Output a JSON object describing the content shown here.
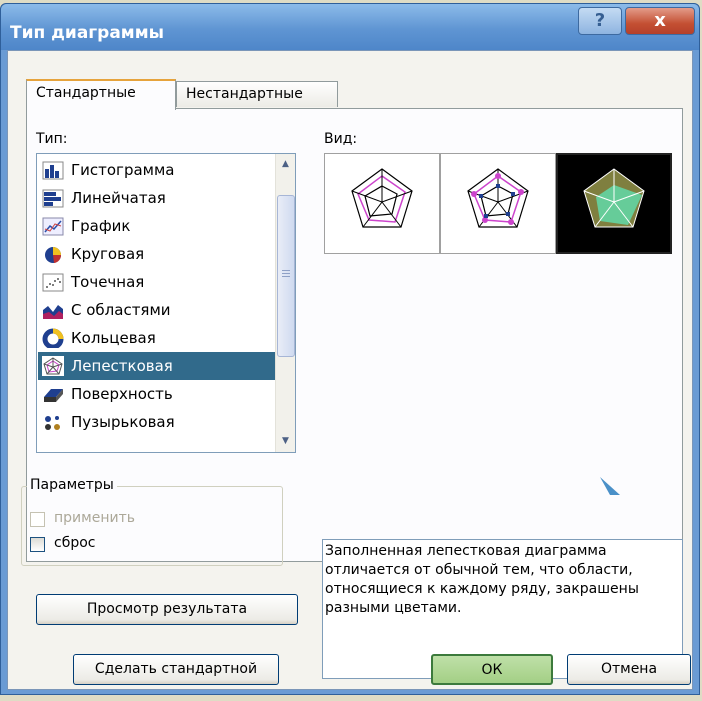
{
  "window": {
    "title": "Тип диаграммы",
    "help_label": "?",
    "close_label": "x"
  },
  "tabs": [
    {
      "label": "Стандартные",
      "active": true
    },
    {
      "label": "Нестандартные",
      "active": false
    }
  ],
  "type_section": {
    "label": "Тип:",
    "items": [
      {
        "label": "Гистограмма",
        "icon": "column-chart-icon"
      },
      {
        "label": "Линейчатая",
        "icon": "bar-chart-icon"
      },
      {
        "label": "График",
        "icon": "line-chart-icon"
      },
      {
        "label": "Круговая",
        "icon": "pie-chart-icon"
      },
      {
        "label": "Точечная",
        "icon": "scatter-chart-icon"
      },
      {
        "label": "С областями",
        "icon": "area-chart-icon"
      },
      {
        "label": "Кольцевая",
        "icon": "doughnut-chart-icon"
      },
      {
        "label": "Лепестковая",
        "icon": "radar-chart-icon",
        "selected": true
      },
      {
        "label": "Поверхность",
        "icon": "surface-chart-icon"
      },
      {
        "label": "Пузырьковая",
        "icon": "bubble-chart-icon"
      }
    ]
  },
  "view_section": {
    "label": "Вид:",
    "subtypes": [
      "radar",
      "radar-with-markers",
      "filled-radar"
    ],
    "selected_index": 2
  },
  "options": {
    "title": "Параметры",
    "apply_label": "применить",
    "apply_enabled": false,
    "reset_label": "сброс"
  },
  "description": "Заполненная лепестковая диаграмма отличается от обычной тем, что области, относящиеся к каждому ряду, закрашены разными цветами.",
  "buttons": {
    "preview": "Просмотр результата",
    "set_default": "Сделать стандартной",
    "ok": "ОК",
    "cancel": "Отмена"
  },
  "colors": {
    "title_bar": "#5f95d3",
    "selection": "#316a8b",
    "radar_line": "#cc44cc",
    "filled_radar_a": "#7f7f3f",
    "filled_radar_b": "#66cc99"
  }
}
